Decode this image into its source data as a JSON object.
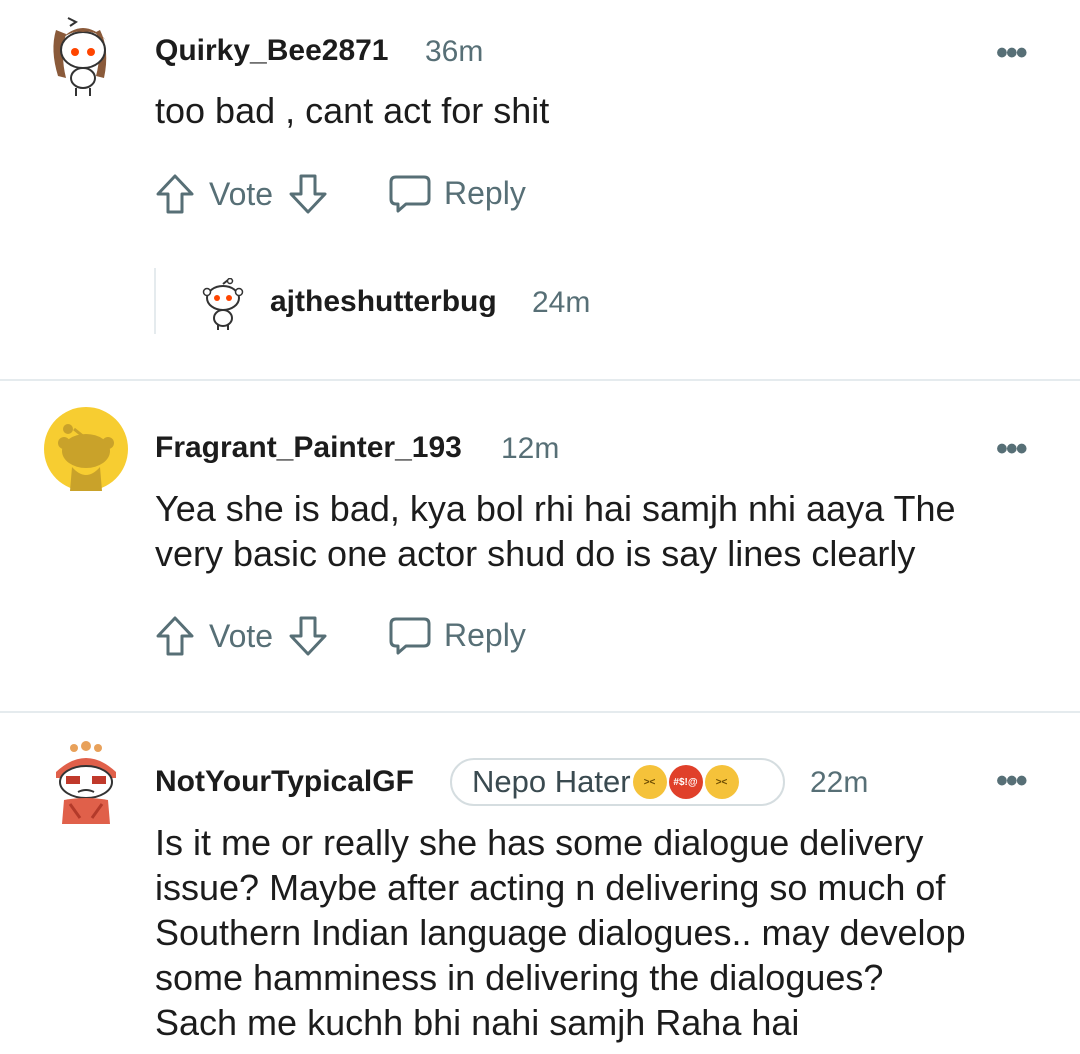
{
  "comments": [
    {
      "username": "Quirky_Bee2871",
      "time": "36m",
      "body_lines": [
        "too bad , cant act for shit"
      ],
      "actions": {
        "vote": "Vote",
        "reply": "Reply"
      }
    },
    {
      "username": "Fragrant_Painter_193",
      "time": "12m",
      "body_lines": [
        "Yea she is bad, kya bol rhi hai samjh nhi aaya The",
        "very basic one actor shud do is say lines clearly"
      ],
      "actions": {
        "vote": "Vote",
        "reply": "Reply"
      }
    },
    {
      "username": "NotYourTypicalGF",
      "flair": "Nepo Hater",
      "time": "22m",
      "body_lines": [
        "Is it me or really she has some dialogue delivery",
        "issue? Maybe after acting n delivering so much of",
        "Southern Indian language dialogues.. may develop",
        "some hamminess in delivering the dialogues?",
        "Sach me kuchh bhi nahi samjh Raha hai"
      ]
    }
  ],
  "reply": {
    "username": "ajtheshutterbug",
    "time": "24m"
  },
  "more_glyph": "•••",
  "flair_emoji_text": "#$!@",
  "colors": {
    "text": "#1c1c1c",
    "meta": "#576f76",
    "divider": "#e5ebee",
    "avatar_yellow": "#f7cd31"
  }
}
